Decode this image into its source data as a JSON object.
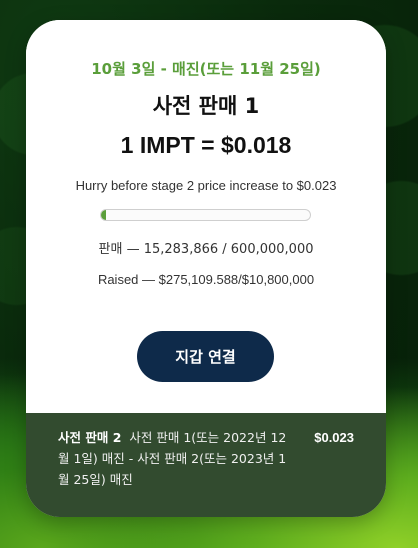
{
  "presale": {
    "date_line": "10월 3일 - 매진(또는 11월 25일)",
    "title": "사전 판매 1",
    "price": "1 IMPT = $0.018",
    "hurry_text": "Hurry before stage 2 price increase to $0.023",
    "progress_fraction": 0.0255,
    "sold_text": "판매 — 15,283,866 / 600,000,000",
    "raised_text": "Raised — $275,109.588/$10,800,000",
    "connect_button_label": "지갑 연결",
    "accent_color": "#5a9e3a",
    "button_color": "#0e2a4a"
  },
  "next_stage": {
    "name": "사전 판매 2",
    "line1": "사전 판매 1(또는 2022년 12",
    "line2": "월 1일) 매진 - 사전 판매 2(또는 2023년 1",
    "line3": "월 25일) 매진",
    "price": "$0.023"
  }
}
